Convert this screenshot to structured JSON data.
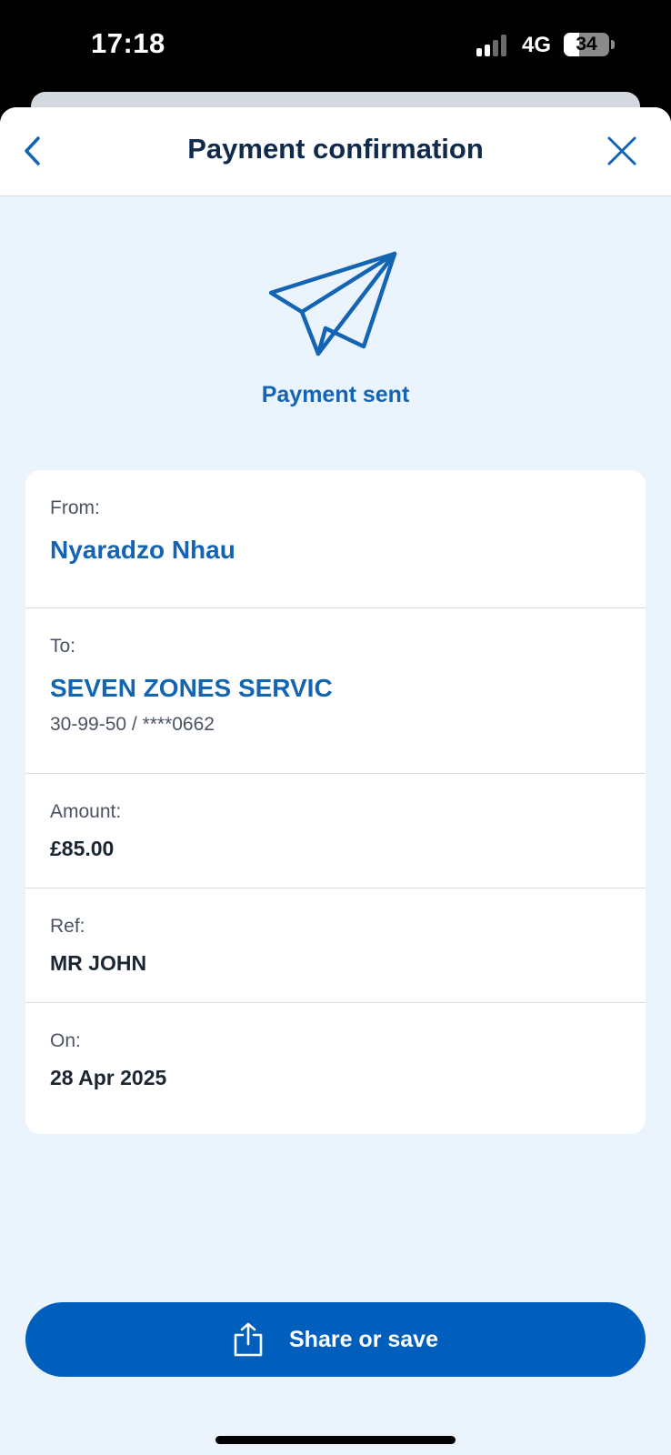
{
  "status_bar": {
    "time": "17:18",
    "network": "4G",
    "battery_percent": 34
  },
  "header": {
    "title": "Payment confirmation",
    "back_icon": "chevron-left-icon",
    "close_icon": "close-icon"
  },
  "confirmation": {
    "icon": "paper-plane-icon",
    "status": "Payment sent"
  },
  "details": {
    "from": {
      "label": "From:",
      "value": "Nyaradzo Nhau"
    },
    "to": {
      "label": "To:",
      "value": "SEVEN ZONES SERVIC",
      "account": "30-99-50 / ****0662"
    },
    "amount": {
      "label": "Amount:",
      "value": "£85.00"
    },
    "ref": {
      "label": "Ref:",
      "value": "MR JOHN"
    },
    "on": {
      "label": "On:",
      "value": "28 Apr 2025"
    }
  },
  "actions": {
    "share_label": "Share or save",
    "share_icon": "share-icon"
  },
  "colors": {
    "accent": "#005fbd",
    "accent_text": "#1464b4",
    "background": "#ebf3fc",
    "title": "#102a4d"
  }
}
